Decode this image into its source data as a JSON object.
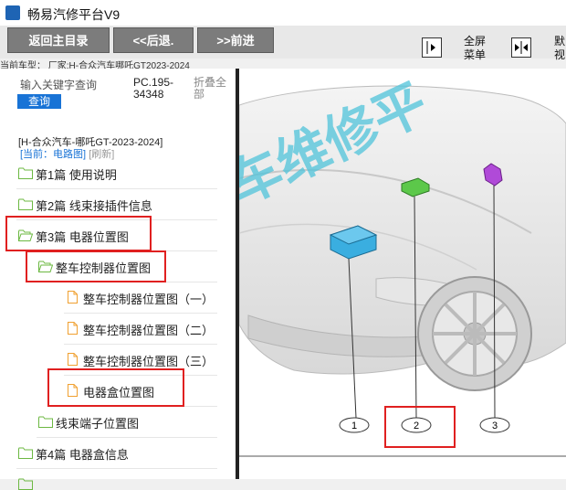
{
  "window": {
    "title": "畅易汽修平台V9"
  },
  "toolbar": {
    "back_main": "返回主目录",
    "prev": "<<后退.",
    "next": ">>前进",
    "fullscreen_label_1": "全屏",
    "fullscreen_label_2": "菜单",
    "extra_label_1": "默",
    "extra_label_2": "视"
  },
  "car_model_bar": "当前车型： 厂家:H-合众汽车哪吒GT2023-2024",
  "sidebar": {
    "search_placeholder": "输入关键字查询",
    "query_button": "查询",
    "pc_code": "PC.195-34348",
    "collapse_all": "折叠全部",
    "current_model": "[H-合众汽车-哪吒GT-2023-2024]",
    "current_view_prefix": "[当前：电路图]",
    "refresh": "[刷新]",
    "tree": [
      {
        "label": "第1篇 使用说明",
        "type": "folder"
      },
      {
        "label": "第2篇 线束接插件信息",
        "type": "folder"
      },
      {
        "label": "第3篇 电器位置图",
        "type": "folder",
        "open": true
      },
      {
        "label": "整车控制器位置图",
        "type": "folder",
        "open": true
      },
      {
        "label": "整车控制器位置图（一）",
        "type": "doc"
      },
      {
        "label": "整车控制器位置图（二）",
        "type": "doc"
      },
      {
        "label": "整车控制器位置图（三）",
        "type": "doc"
      },
      {
        "label": "电器盒位置图",
        "type": "doc"
      },
      {
        "label": "线束端子位置图",
        "type": "folder"
      },
      {
        "label": "第4篇 电器盒信息",
        "type": "folder"
      }
    ]
  },
  "diagram": {
    "watermark": "车维修平",
    "callouts": [
      "1",
      "2",
      "3"
    ]
  },
  "colors": {
    "accent": "#1873d6",
    "highlight": "#e02020",
    "component_1": "#3aaee0",
    "component_2": "#5cc84a",
    "component_3": "#b04ad8",
    "folder": "#6cb842",
    "doc": "#f0a030"
  }
}
